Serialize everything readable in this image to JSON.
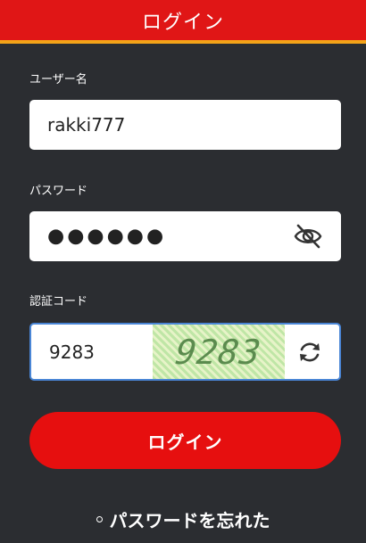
{
  "header": {
    "title": "ログイン"
  },
  "username": {
    "label": "ユーザー名",
    "value": "rakki777"
  },
  "password": {
    "label": "パスワード",
    "masked_value": "●●●●●●",
    "icon": "eye-slash-icon"
  },
  "captcha": {
    "label": "認証コード",
    "value": "9283",
    "image_text": "9283",
    "icon": "refresh-icon"
  },
  "login_button": {
    "label": "ログイン"
  },
  "forgot": {
    "label": "パスワードを忘れた"
  },
  "colors": {
    "header": "#e01616",
    "header_stripe": "#f3a318",
    "background": "#2b2d31",
    "button": "#e60f0f",
    "focus_border": "#4a86d6"
  }
}
